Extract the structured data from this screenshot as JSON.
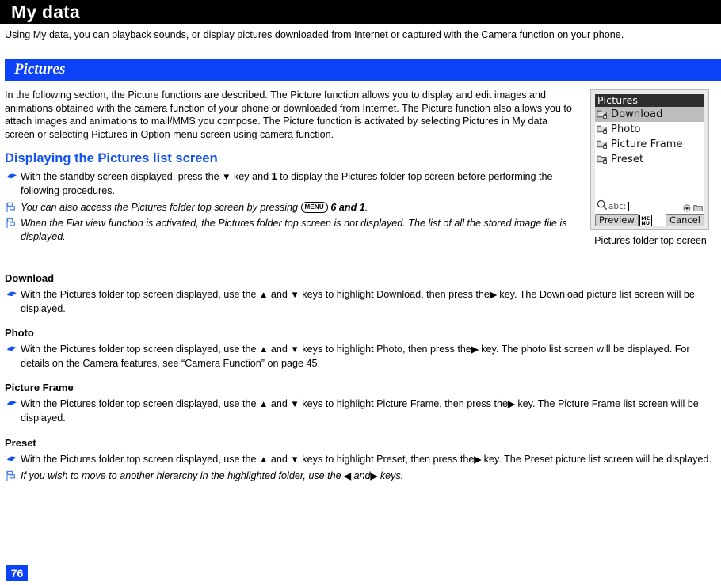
{
  "header": {
    "title": "My data"
  },
  "intro": "Using My data, you can playback sounds, or display pictures downloaded from Internet or captured with the Camera function on your phone.",
  "section": {
    "title": "Pictures",
    "accent_color": "#0B41F7"
  },
  "body": {
    "paragraph": "In the following section, the Picture functions are described.  The Picture function allows you to display and edit images and animations obtained with the camera function of your phone or downloaded from Internet.  The Picture function also allows you to attach images and animations to mail/MMS you compose.  The Picture function is activated by selecting Pictures in My data screen or selecting Pictures in Option menu screen using camera function."
  },
  "displaying": {
    "heading": "Displaying the Pictures list screen",
    "heading_color": "#1152F0",
    "step": {
      "part1": "With the standby screen displayed, press the ",
      "key_down": "▼",
      "part2": " key and ",
      "key_one": "1",
      "part3": " to display the Pictures folder top screen before performing the following procedures."
    },
    "note1": {
      "part1": "You can also access the Pictures folder top screen by pressing ",
      "menu_key": "MENU",
      "part2": " 6 and 1",
      "part3": "."
    },
    "note2": "When the Flat view function is activated, the Pictures folder top screen is not displayed. The list of all the stored image file is displayed."
  },
  "sections": [
    {
      "heading": "Download",
      "step": {
        "part1": "With the Pictures folder top screen displayed, use the ",
        "key_up": "▲",
        "part2": " and ",
        "key_down": "▼",
        "part3": " keys to highlight Download, then press the",
        "key_right": "▶",
        "part4": " key. The Download picture list screen will be displayed."
      }
    },
    {
      "heading": "Photo",
      "step": {
        "part1": "With the Pictures folder top screen displayed, use the ",
        "key_up": "▲",
        "part2": " and ",
        "key_down": "▼",
        "part3": " keys to highlight Photo, then press the",
        "key_right": "▶",
        "part4": " key. The photo list screen will be displayed. For details on the Camera features, see “Camera Function” on page 45."
      }
    },
    {
      "heading": "Picture Frame",
      "step": {
        "part1": "With the Pictures folder top screen displayed, use the ",
        "key_up": "▲",
        "part2": " and ",
        "key_down": "▼",
        "part3": " keys to highlight Picture Frame, then press the",
        "key_right": "▶",
        "part4": " key. The Picture Frame list screen will be displayed."
      }
    },
    {
      "heading": "Preset",
      "step": {
        "part1": "With the Pictures folder top screen displayed, use the ",
        "key_up": "▲",
        "part2": " and ",
        "key_down": "▼",
        "part3": " keys to highlight Preset, then press the",
        "key_right": "▶",
        "part4": " key. The Preset picture list screen will be displayed."
      }
    }
  ],
  "final_note": {
    "part1": "If you wish to move to another hierarchy in the highlighted folder, use the  ",
    "key_left": "◀",
    "part2": " and",
    "key_right": "▶",
    "part3": " keys."
  },
  "figure": {
    "caption": "Pictures folder top screen",
    "screen": {
      "title": "Pictures",
      "items": [
        {
          "label": "Download",
          "selected": true
        },
        {
          "label": "Photo",
          "selected": false
        },
        {
          "label": "Picture Frame",
          "selected": false
        },
        {
          "label": "Preset",
          "selected": false
        }
      ],
      "search_mode": "abc:",
      "softkey_left": "Preview",
      "softkey_center": "MENU",
      "softkey_right": "Cancel"
    }
  },
  "footer": {
    "page_number": "76"
  }
}
